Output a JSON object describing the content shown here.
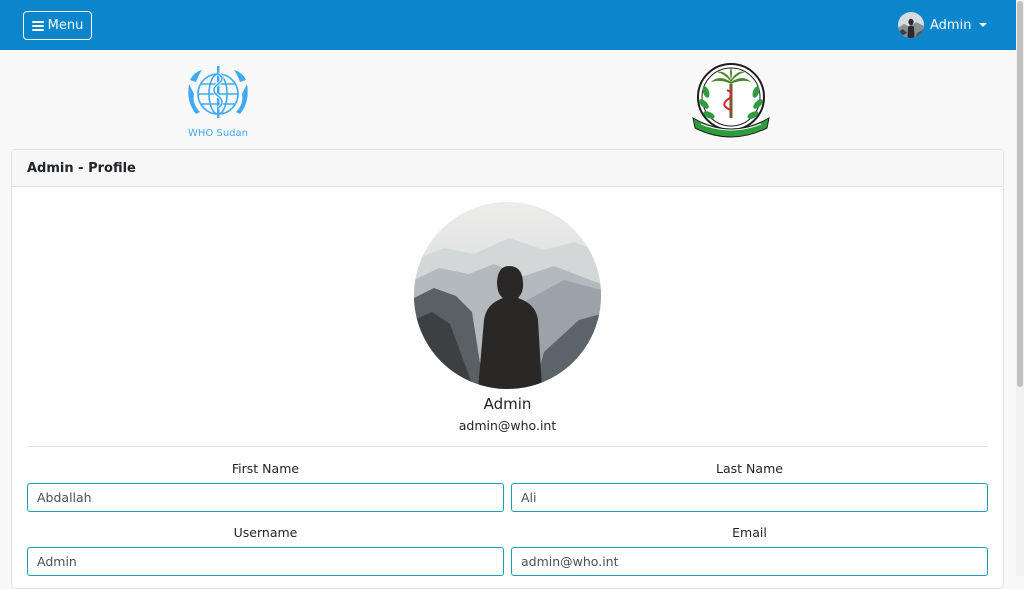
{
  "navbar": {
    "menu_label": "Menu",
    "user_name": "Admin",
    "bg_color": "#0b86cc"
  },
  "logos": {
    "who_caption": "WHO Sudan"
  },
  "card": {
    "title": "Admin - Profile"
  },
  "profile": {
    "name": "Admin",
    "email": "admin@who.int"
  },
  "form": {
    "first_name": {
      "label": "First Name",
      "value": "Abdallah"
    },
    "last_name": {
      "label": "Last Name",
      "value": "Ali"
    },
    "username": {
      "label": "Username",
      "value": "Admin"
    },
    "email": {
      "label": "Email",
      "value": "admin@who.int"
    }
  },
  "colors": {
    "accent": "#0b86cc",
    "input_border": "#17a2b8",
    "who_blue": "#3fa9f5"
  }
}
